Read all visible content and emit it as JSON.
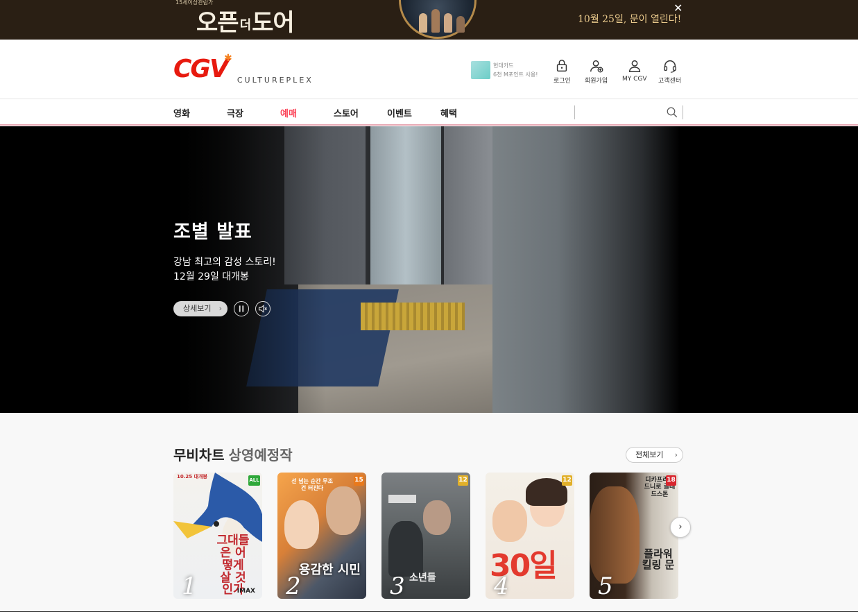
{
  "top_banner": {
    "age_note": "15세이상관람가",
    "title_part1": "오픈",
    "title_part2": "더",
    "title_part3": "도어",
    "release_text": "10월 25일, 문이 열린다!",
    "close_label": "✕"
  },
  "header": {
    "logo": "CGV",
    "logo_sub": "CULTUREPLEX",
    "card_promo": {
      "line1": "현대카드",
      "line2": "6천 M포인트 사용!"
    },
    "utilities": [
      {
        "label": "로그인",
        "icon": "lock-icon"
      },
      {
        "label": "회원가입",
        "icon": "add-user-icon"
      },
      {
        "label": "MY CGV",
        "icon": "user-icon"
      },
      {
        "label": "고객센터",
        "icon": "headset-icon"
      }
    ]
  },
  "nav": {
    "items": [
      {
        "label": "영화"
      },
      {
        "label": "극장"
      },
      {
        "label": "예매",
        "active": true
      },
      {
        "label": "스토어"
      },
      {
        "label": "이벤트"
      },
      {
        "label": "혜택"
      }
    ],
    "search_placeholder": ""
  },
  "hero": {
    "title": "조별 발표",
    "desc_line1": "강남 최고의 감성 스토리!",
    "desc_line2": "12월 29일 대개봉",
    "detail_label": "상세보기"
  },
  "chart": {
    "tab_active": "무비차트",
    "tab_other": "상영예정작",
    "view_all": "전체보기",
    "movies": [
      {
        "rank": "1",
        "rating": "ALL",
        "rating_color": "#2fa83a",
        "tag": "10.25 대개봉",
        "title": "그대들은 어떻게 살 것인가",
        "bottom": "IMAX"
      },
      {
        "rank": "2",
        "rating": "15",
        "rating_color": "#e8791c",
        "tag": "선 넘는 순간 무조건 터진다",
        "title": "용감한 시민",
        "bottom": ""
      },
      {
        "rank": "3",
        "rating": "12",
        "rating_color": "#e1b02a",
        "tag": "",
        "title": "소년들",
        "bottom": ""
      },
      {
        "rank": "4",
        "rating": "12",
        "rating_color": "#e1b02a",
        "tag": "",
        "title": "30일",
        "bottom": ""
      },
      {
        "rank": "5",
        "rating": "18",
        "rating_color": "#d8262e",
        "tag": "디카프리오 드니로 글래드스톤",
        "title": "플라워 킬링 문",
        "bottom": ""
      }
    ]
  }
}
